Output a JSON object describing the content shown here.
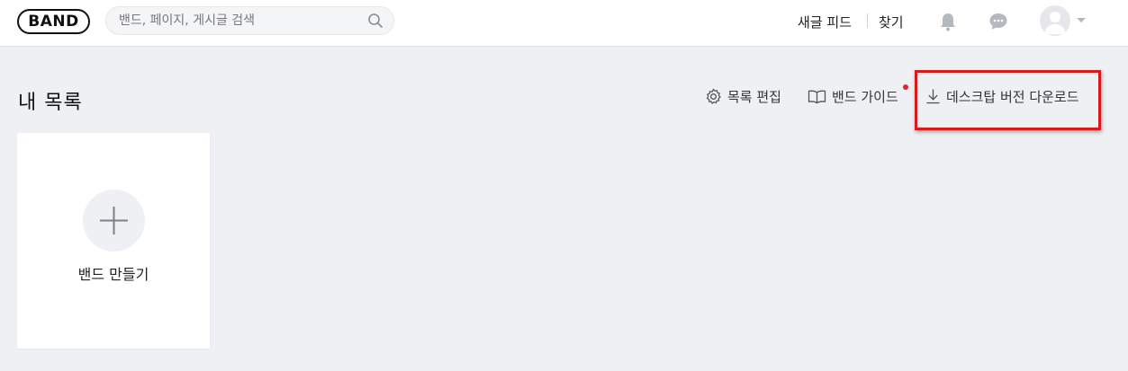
{
  "header": {
    "logo": "BAND",
    "search": {
      "placeholder": "밴드, 페이지, 게시글 검색",
      "value": ""
    },
    "nav": {
      "new_feed": "새글 피드",
      "find": "찾기"
    },
    "icons": [
      "search-icon",
      "bell-icon",
      "chat-icon",
      "avatar-icon",
      "caret-down-icon"
    ]
  },
  "main": {
    "title": "내 목록",
    "toolbar": {
      "edit_list": "목록 편집",
      "band_guide": "밴드 가이드",
      "desktop_download": "데스크탑 버전 다운로드"
    },
    "create_card": {
      "label": "밴드 만들기"
    }
  },
  "colors": {
    "background": "#eef0f4",
    "highlight": "#d91a1a",
    "notification_dot": "#e8202e"
  }
}
